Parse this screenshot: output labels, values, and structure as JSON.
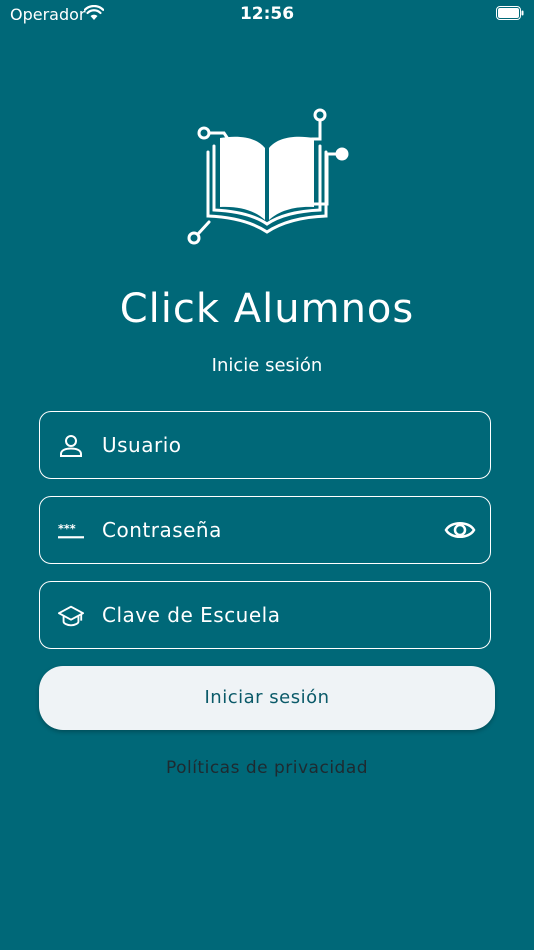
{
  "status_bar": {
    "carrier": "Operador",
    "time": "12:56"
  },
  "app": {
    "title": "Click Alumnos",
    "subtitle": "Inicie sesión"
  },
  "form": {
    "username": {
      "value": "",
      "placeholder": "Usuario",
      "icon": "user-icon"
    },
    "password": {
      "value": "",
      "placeholder": "Contraseña",
      "icon": "password-icon",
      "toggle_icon": "eye-icon"
    },
    "school_key": {
      "value": "",
      "placeholder": "Clave de Escuela",
      "icon": "graduation-cap-icon"
    }
  },
  "actions": {
    "login_label": "Iniciar sesión",
    "privacy_label": "Políticas de privacidad"
  },
  "colors": {
    "background": "#006878",
    "button_bg": "#eff3f6",
    "button_text": "#0b5a69",
    "link_text": "#1e2a30"
  }
}
